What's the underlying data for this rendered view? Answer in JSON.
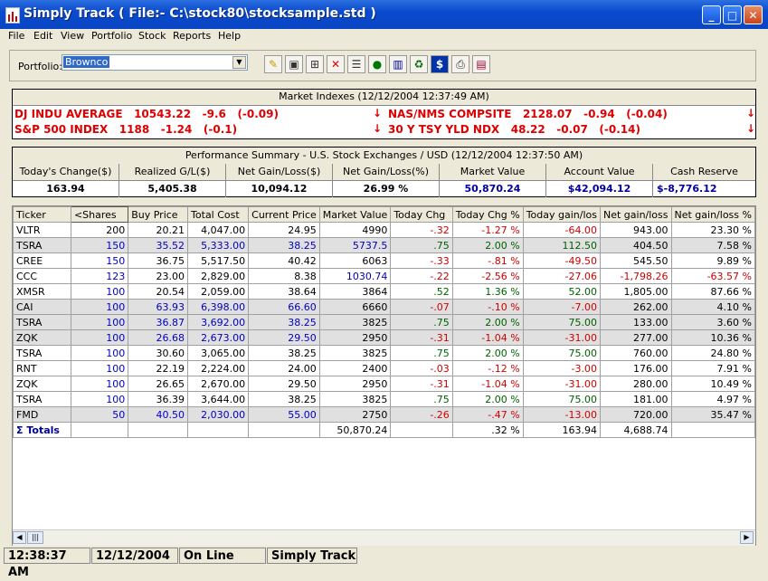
{
  "window": {
    "title": "Simply Track ( File:- C:\\stock80\\stocksample.std )",
    "min": "_",
    "max": "□",
    "close": "✕"
  },
  "menu": [
    "File",
    "Edit",
    "View",
    "Portfolio",
    "Stock",
    "Reports",
    "Help"
  ],
  "toolbar": {
    "portfolio_label": "Portfolio:",
    "portfolio_value": "Brownco"
  },
  "toolbar_icons": [
    "edit-pencil-icon",
    "save-icon",
    "add-icon",
    "delete-icon",
    "properties-icon",
    "traffic-light-icon",
    "chart-icon",
    "recycle-icon",
    "dollar-icon",
    "print-icon",
    "book-icon"
  ],
  "market": {
    "header": "Market Indexes (12/12/2004 12:37:49 AM)",
    "rows": [
      {
        "name": "DJ INDU AVERAGE",
        "value": "10543.22",
        "chg": "-9.6",
        "pct": "(-0.09)"
      },
      {
        "name": "NAS/NMS COMPSITE",
        "value": "2128.07",
        "chg": "-0.94",
        "pct": "(-0.04)"
      },
      {
        "name": "S&P 500 INDEX",
        "value": "1188",
        "chg": "-1.24",
        "pct": "(-0.1)"
      },
      {
        "name": "30 Y TSY YLD NDX",
        "value": "48.22",
        "chg": "-0.07",
        "pct": "(-0.14)"
      }
    ]
  },
  "performance": {
    "header": "Performance Summary - U.S. Stock Exchanges / USD (12/12/2004 12:37:50 AM)",
    "columns": [
      "Today's Change($)",
      "Realized G/L($)",
      "Net Gain/Loss($)",
      "Net Gain/Loss(%)",
      "Market Value",
      "Account Value",
      "Cash Reserve"
    ],
    "values": [
      "163.94",
      "5,405.38",
      "10,094.12",
      "26.99 %",
      "50,870.24",
      "$42,094.12",
      "$-8,776.12"
    ]
  },
  "grid": {
    "columns": [
      "Ticker",
      "<Shares",
      "Buy Price",
      "Total Cost",
      "Current Price",
      "Market Value",
      "Today Chg",
      "Today Chg %",
      "Today gain/los",
      "Net gain/loss",
      "Net gain/loss %"
    ],
    "rows": [
      [
        "VLTR",
        "200",
        "20.21",
        "4,047.00",
        "24.95",
        "4990",
        "-.32",
        "-1.27 %",
        "-64.00",
        "943.00",
        "23.30 %"
      ],
      [
        "TSRA",
        "150",
        "35.52",
        "5,333.00",
        "38.25",
        "5737.5",
        ".75",
        "2.00 %",
        "112.50",
        "404.50",
        "7.58 %"
      ],
      [
        "CREE",
        "150",
        "36.75",
        "5,517.50",
        "40.42",
        "6063",
        "-.33",
        "-.81 %",
        "-49.50",
        "545.50",
        "9.89 %"
      ],
      [
        "CCC",
        "123",
        "23.00",
        "2,829.00",
        "8.38",
        "1030.74",
        "-.22",
        "-2.56 %",
        "-27.06",
        "-1,798.26",
        "-63.57 %"
      ],
      [
        "XMSR",
        "100",
        "20.54",
        "2,059.00",
        "38.64",
        "3864",
        ".52",
        "1.36 %",
        "52.00",
        "1,805.00",
        "87.66 %"
      ],
      [
        "CAI",
        "100",
        "63.93",
        "6,398.00",
        "66.60",
        "6660",
        "-.07",
        "-.10 %",
        "-7.00",
        "262.00",
        "4.10 %"
      ],
      [
        "TSRA",
        "100",
        "36.87",
        "3,692.00",
        "38.25",
        "3825",
        ".75",
        "2.00 %",
        "75.00",
        "133.00",
        "3.60 %"
      ],
      [
        "ZQK",
        "100",
        "26.68",
        "2,673.00",
        "29.50",
        "2950",
        "-.31",
        "-1.04 %",
        "-31.00",
        "277.00",
        "10.36 %"
      ],
      [
        "TSRA",
        "100",
        "30.60",
        "3,065.00",
        "38.25",
        "3825",
        ".75",
        "2.00 %",
        "75.00",
        "760.00",
        "24.80 %"
      ],
      [
        "RNT",
        "100",
        "22.19",
        "2,224.00",
        "24.00",
        "2400",
        "-.03",
        "-.12 %",
        "-3.00",
        "176.00",
        "7.91 %"
      ],
      [
        "ZQK",
        "100",
        "26.65",
        "2,670.00",
        "29.50",
        "2950",
        "-.31",
        "-1.04 %",
        "-31.00",
        "280.00",
        "10.49 %"
      ],
      [
        "TSRA",
        "100",
        "36.39",
        "3,644.00",
        "38.25",
        "3825",
        ".75",
        "2.00 %",
        "75.00",
        "181.00",
        "4.97 %"
      ],
      [
        "FMD",
        "50",
        "40.50",
        "2,030.00",
        "55.00",
        "2750",
        "-.26",
        "-.47 %",
        "-13.00",
        "720.00",
        "35.47 %"
      ]
    ],
    "totals": {
      "label": "Σ Totals",
      "market_value": "50,870.24",
      "today_chg_pct": ".32 %",
      "today_gain": "163.94",
      "net_gain": "4,688.74"
    }
  },
  "status": {
    "time": "12:38:37 AM",
    "date": "12/12/2004",
    "conn": "On Line",
    "app": "Simply Track"
  }
}
